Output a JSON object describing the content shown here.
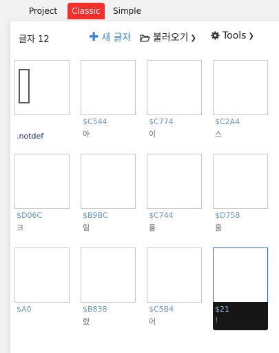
{
  "tabs": [
    {
      "label": "Project"
    },
    {
      "label": "Classic"
    },
    {
      "label": "Simple"
    }
  ],
  "accent_color": "#f22f2a",
  "toolbar": {
    "glyph_count": "글자 12",
    "new_glyph": "새 글자",
    "load": "불러오기",
    "tools": "Tools"
  },
  "glyphs": [
    {
      "label": ".notdef"
    },
    {
      "code": "$C544",
      "char": "아"
    },
    {
      "code": "$C774",
      "char": "이"
    },
    {
      "code": "$C2A4",
      "char": "스"
    },
    {
      "code": "$D06C",
      "char": "크"
    },
    {
      "code": "$B9BC",
      "char": "림"
    },
    {
      "code": "$C744",
      "char": "을"
    },
    {
      "code": "$D758",
      "char": "흘"
    },
    {
      "code": "$A0",
      "char": ""
    },
    {
      "code": "$B838",
      "char": "렸"
    },
    {
      "code": "$C5B4",
      "char": "어"
    },
    {
      "code": "$21",
      "char": "!"
    }
  ]
}
